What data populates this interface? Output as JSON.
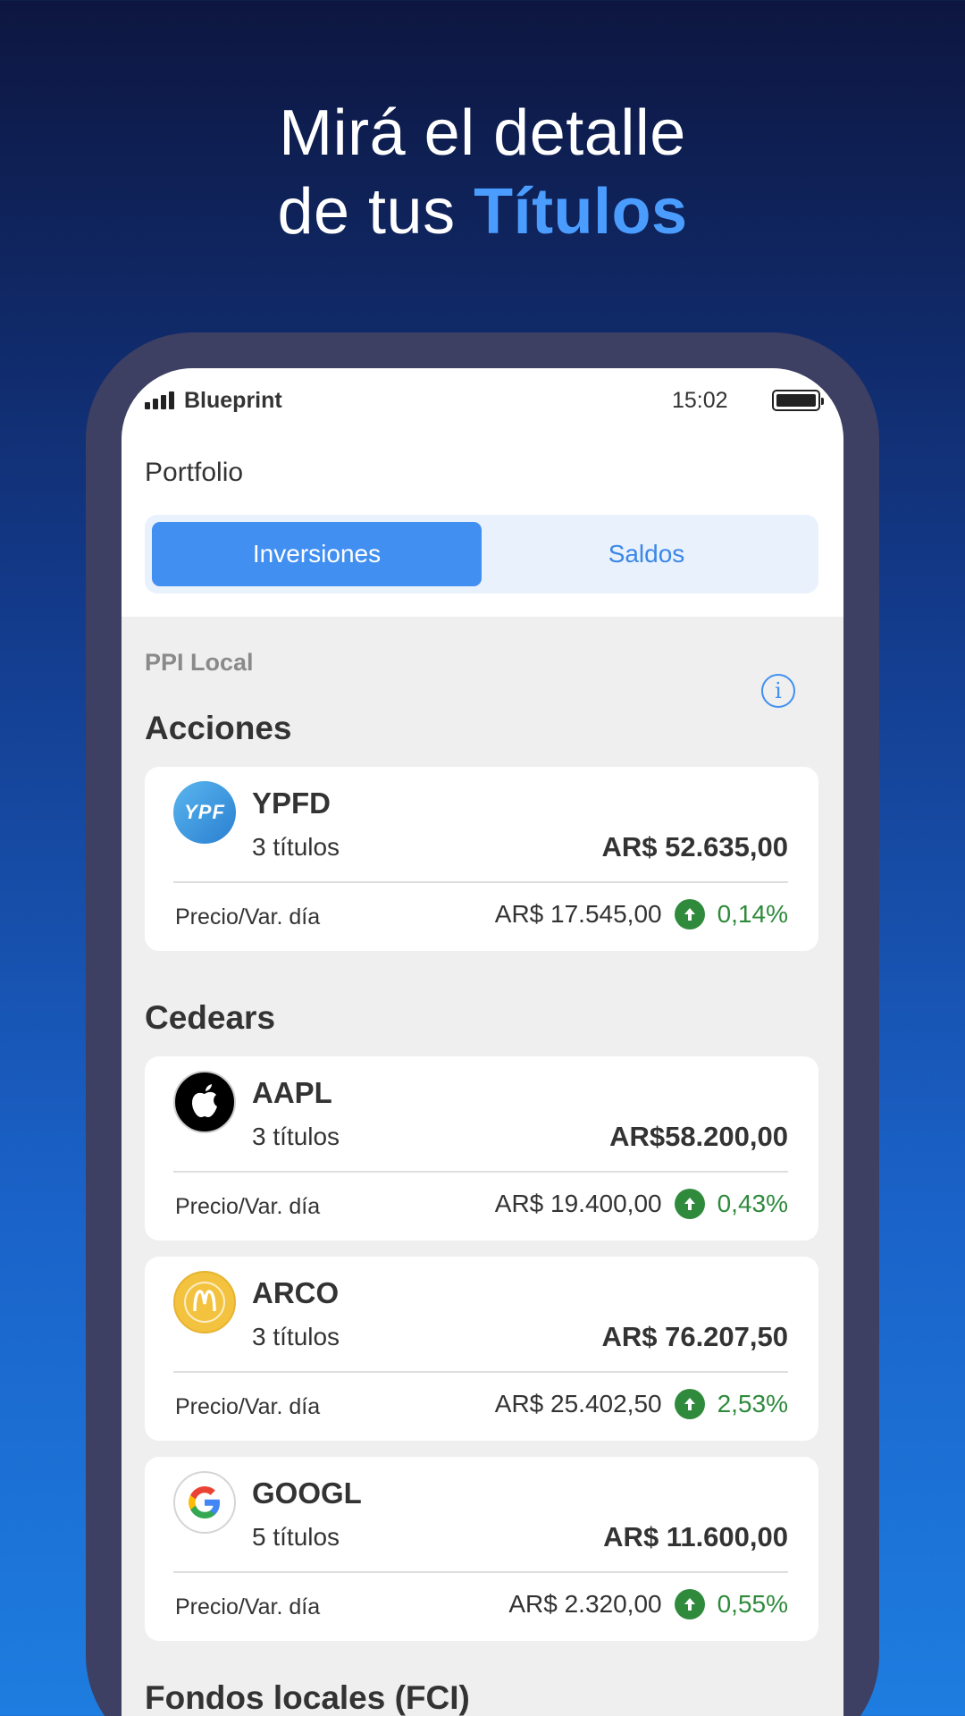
{
  "headline": {
    "line1": "Mirá el detalle",
    "line2_prefix": "de tus",
    "line2_accent": "Títulos"
  },
  "status_bar": {
    "carrier": "Blueprint",
    "time": "15:02"
  },
  "page": {
    "title": "Portfolio"
  },
  "tabs": [
    {
      "label": "Inversiones",
      "active": true
    },
    {
      "label": "Saldos",
      "active": false
    }
  ],
  "group_label": "PPI Local",
  "sections": {
    "acciones": "Acciones",
    "cedears": "Cedears",
    "fci": "Fondos locales (FCI)"
  },
  "price_label": "Precio/Var. día",
  "holdings": [
    {
      "ticker": "YPFD",
      "qty": "3 títulos",
      "total": "AR$ 52.635,00",
      "price": "AR$ 17.545,00",
      "variation": "0,14%",
      "logo": "ypf-logo",
      "logo_text": "YPF"
    },
    {
      "ticker": "AAPL",
      "qty": "3 títulos",
      "total": "AR$58.200,00",
      "price": "AR$ 19.400,00",
      "variation": "0,43%",
      "logo": "apple-logo"
    },
    {
      "ticker": "ARCO",
      "qty": "3 títulos",
      "total": "AR$ 76.207,50",
      "price": "AR$ 25.402,50",
      "variation": "2,53%",
      "logo": "mcdonalds-logo"
    },
    {
      "ticker": "GOOGL",
      "qty": "5 títulos",
      "total": "AR$ 11.600,00",
      "price": "AR$ 2.320,00",
      "variation": "0,55%",
      "logo": "google-logo"
    }
  ],
  "colors": {
    "accent": "#418ff1",
    "positive": "#2f8a3c",
    "frame": "#3d3f63"
  },
  "icons": [
    "signal-icon",
    "battery-icon",
    "info-icon",
    "arrow-up-icon"
  ]
}
